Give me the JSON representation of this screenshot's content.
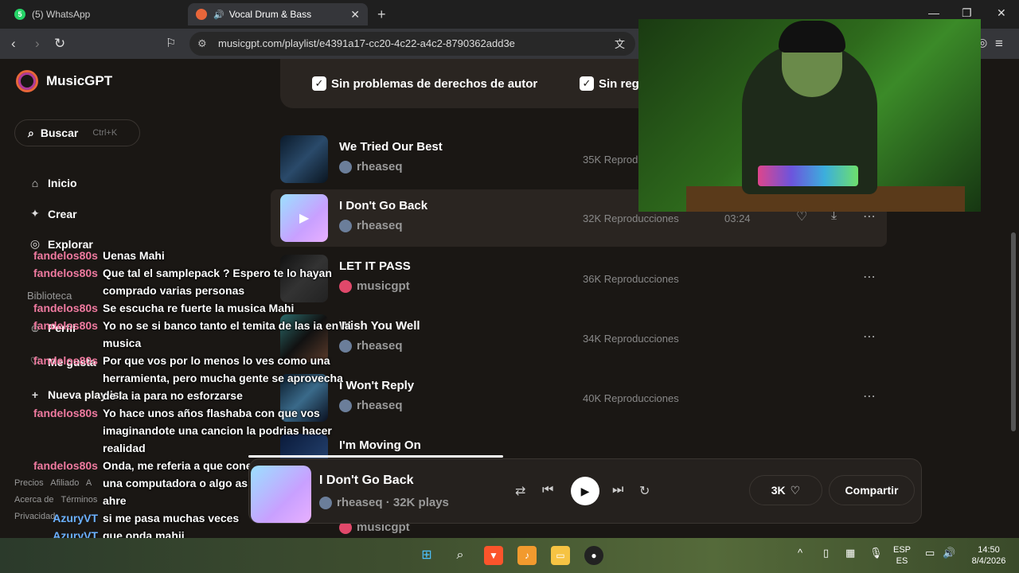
{
  "browser": {
    "tabs": [
      {
        "label": "(5) WhatsApp",
        "badge": "5"
      },
      {
        "label": "Vocal Drum & Bass"
      }
    ],
    "url": "musicgpt.com/playlist/e4391a17-cc20-4c22-a4c2-8790362add3e"
  },
  "sidebar": {
    "brand": "MusicGPT",
    "search_label": "Buscar",
    "search_shortcut": "Ctrl+K",
    "items": [
      {
        "label": "Inicio",
        "icon": "home-icon"
      },
      {
        "label": "Crear",
        "icon": "sparkle-icon"
      },
      {
        "label": "Explorar",
        "icon": "compass-icon"
      }
    ],
    "section_label": "Biblioteca",
    "library": [
      {
        "label": "Perfil",
        "icon": "user-icon"
      },
      {
        "label": "Me gusta",
        "icon": "heart-icon"
      },
      {
        "label": "Nueva playlist",
        "icon": "plus-icon"
      }
    ],
    "footer_row1": [
      "Precios",
      "Afiliado",
      "A"
    ],
    "footer_row2": [
      "Acerca de",
      "Términos"
    ],
    "footer_row3": [
      "Privacidad"
    ]
  },
  "filters": {
    "copyright": "Sin problemas de derechos de autor",
    "royalty": "Sin reg"
  },
  "tracks": [
    {
      "title": "We Tried Our Best",
      "artist": "rheaseq",
      "plays": "35K Reprod"
    },
    {
      "title": "I Don't Go Back",
      "artist": "rheaseq",
      "plays": "32K Reproducciones",
      "duration": "03:24"
    },
    {
      "title": "LET IT PASS",
      "artist": "musicgpt",
      "plays": "36K Reproducciones"
    },
    {
      "title": "Wish You Well",
      "artist": "rheaseq",
      "plays": "34K Reproducciones"
    },
    {
      "title": "I Won't Reply",
      "artist": "rheaseq",
      "plays": "40K Reproducciones"
    },
    {
      "title": "I'm Moving On",
      "artist": "",
      "plays": ""
    }
  ],
  "hidden_artist": "musicgpt",
  "player": {
    "title": "I Don't Go Back",
    "subtitle": "rheaseq · 32K plays",
    "likes": "3K",
    "share_label": "Compartir"
  },
  "chat": [
    {
      "user": "fandelos80s",
      "text": "Uenas Mahi"
    },
    {
      "user": "fandelos80s",
      "text": "Que tal el samplepack ? Espero te lo hayan comprado varias personas"
    },
    {
      "user": "fandelos80s",
      "text": "Se escucha re fuerte la musica Mahi"
    },
    {
      "user": "fandelos80s",
      "text": "Yo no se si banco tanto el temita de las ia en la musica"
    },
    {
      "user": "fandelos80s",
      "text": "Por que vos por lo menos lo ves como una herramienta, pero mucha gente se aprovecha de la ia para no esforzarse"
    },
    {
      "user": "fandelos80s",
      "text": "Yo hace unos años flashaba con que vos imaginandote una cancion la podrias hacer realidad"
    },
    {
      "user": "fandelos80s",
      "text": "Onda, me referia a que conectando tu mente a una computadora o algo asi. Bien futurista ahre"
    },
    {
      "user": "AzuryVT",
      "text": "si me pasa muchas veces"
    },
    {
      "user": "AzuryVT",
      "text": "que onda mahii"
    }
  ],
  "taskbar": {
    "lang_top": "ESP",
    "lang_bottom": "ES",
    "time": "14:50",
    "date": "8/4/2026"
  },
  "colors": {
    "accent": "#e8663a",
    "chat_user": "#f07aa0",
    "chat_user_alt": "#6ab0ff"
  }
}
